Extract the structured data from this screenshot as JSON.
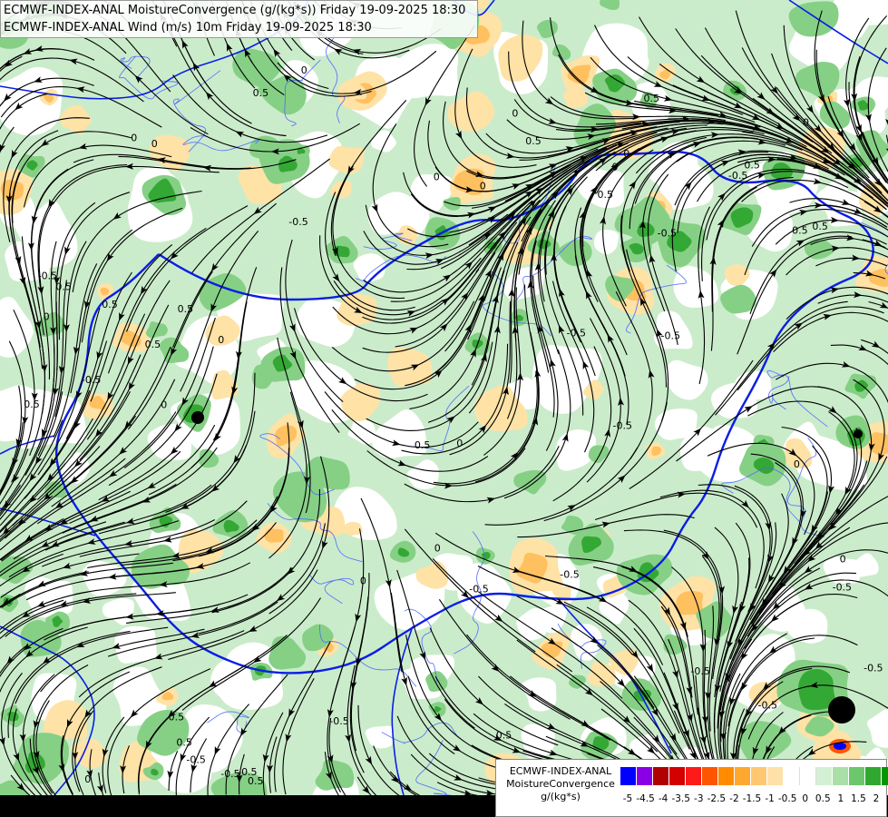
{
  "header": {
    "line1": "ECMWF-INDEX-ANAL MoistureConvergence (g/(kg*s)) Friday 19-09-2025 18:30",
    "line2": "ECMWF-INDEX-ANAL Wind (m/s) 10m Friday 19-09-2025 18:30"
  },
  "legend": {
    "model": "ECMWF-INDEX-ANAL",
    "parameter": "MoistureConvergence",
    "unit": "g/(kg*s)",
    "colors": [
      "#0000ff",
      "#8a00e6",
      "#b00000",
      "#d20000",
      "#ff1a1a",
      "#ff5500",
      "#ff8c00",
      "#ffa830",
      "#ffc870",
      "#ffe0a8",
      "#ffffff",
      "#ffffff",
      "#d4f0d4",
      "#a8e0a8",
      "#6cc66c",
      "#30a830",
      "#009600"
    ],
    "ticks": [
      "-5",
      "-4.5",
      "-4",
      "-3.5",
      "-3",
      "-2.5",
      "-2",
      "-1.5",
      "-1",
      "-0.5",
      "0",
      "0.5",
      "1",
      "1.5",
      "2"
    ]
  },
  "map": {
    "contour_labels": [
      "0",
      "0.5",
      "-0.5"
    ],
    "colors": {
      "border": "#0a1ee6",
      "river": "#4a64ff",
      "streamline": "#000000",
      "convergence_light": "#cbeccb",
      "convergence_mid": "#86d086",
      "convergence_strong": "#34a834",
      "divergence_light": "#ffe2a6",
      "divergence_mid": "#ffc060"
    }
  }
}
